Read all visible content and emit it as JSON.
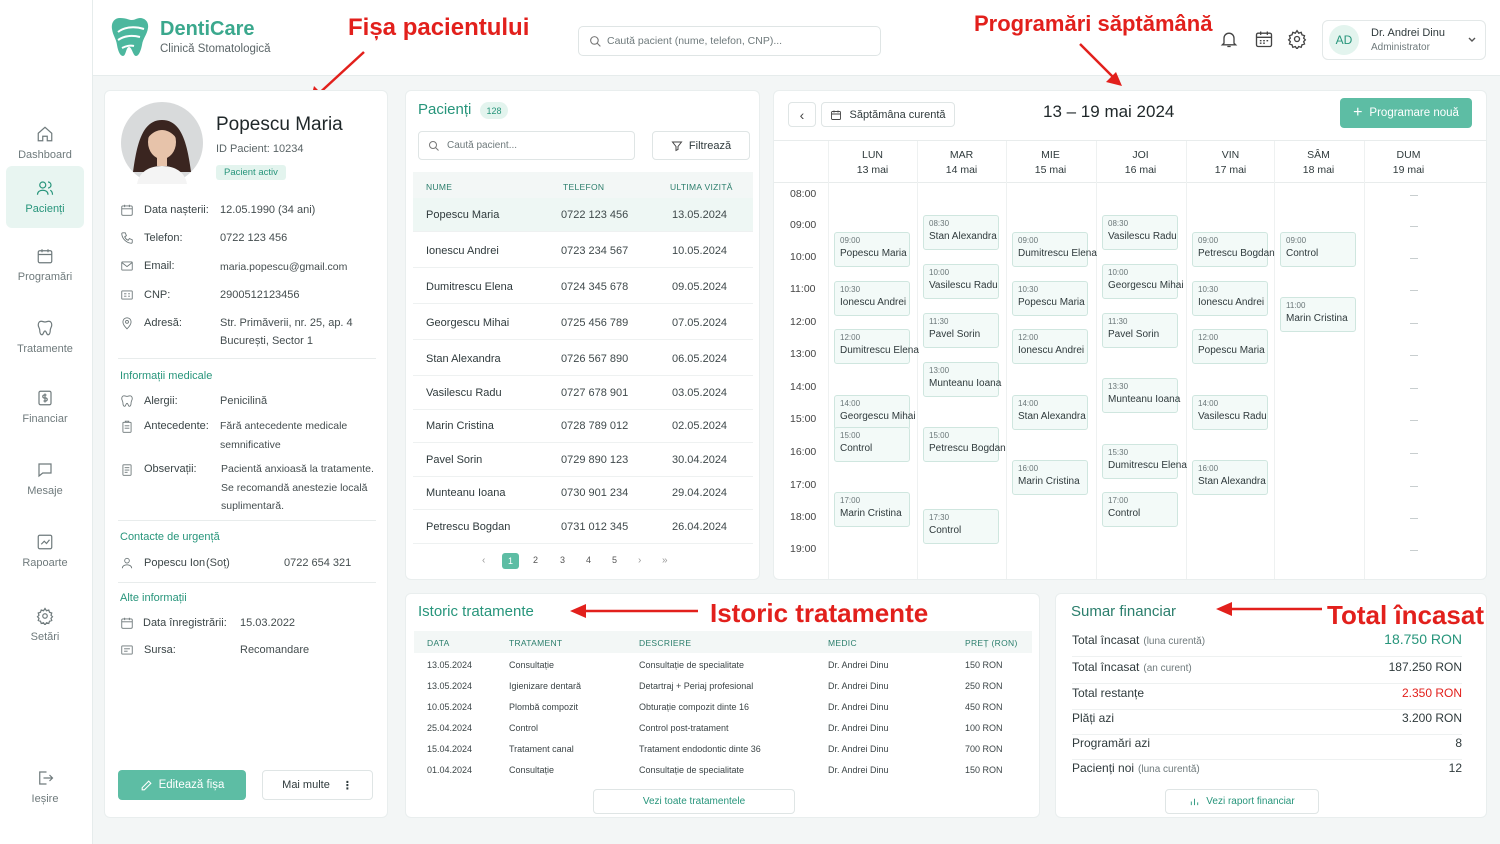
{
  "app": {
    "name": "DentiCare",
    "subtitle": "Clinică Stomatologică"
  },
  "header": {
    "search_placeholder": "Caută pacient (nume, telefon, CNP)...",
    "user_initials": "AD",
    "user_name": "Dr. Andrei Dinu",
    "user_role": "Administrator"
  },
  "annotations": {
    "fisa": "Fișa pacientului",
    "programari": "Programări săptămână",
    "istoric": "Istoric tratamente",
    "total": "Total încasat"
  },
  "sidebar": {
    "items": [
      {
        "label": "Dashboard",
        "icon": "home-icon"
      },
      {
        "label": "Pacienți",
        "icon": "users-icon"
      },
      {
        "label": "Programări",
        "icon": "calendar-icon"
      },
      {
        "label": "Tratamente",
        "icon": "tooth-icon"
      },
      {
        "label": "Financiar",
        "icon": "dollar-icon"
      },
      {
        "label": "Mesaje",
        "icon": "message-icon"
      },
      {
        "label": "Rapoarte",
        "icon": "chart-icon"
      },
      {
        "label": "Setări",
        "icon": "gear-icon"
      }
    ],
    "logout": "Ieșire"
  },
  "patient": {
    "name": "Popescu Maria",
    "id": "ID Pacient: 10234",
    "status": "Pacient activ",
    "fields": [
      {
        "label": "Data nașterii:",
        "value": "12.05.1990",
        "extra": "(34 ani)"
      },
      {
        "label": "Telefon:",
        "value": "0722 123 456"
      },
      {
        "label": "Email:",
        "value": "maria.popescu@gmail.com"
      },
      {
        "label": "CNP:",
        "value": "2900512123456"
      },
      {
        "label": "Adresă:",
        "value": "Str. Primăverii, nr. 25, ap. 4",
        "value2": "București, Sector 1"
      }
    ],
    "medical_title": "Informații medicale",
    "medical": [
      {
        "label": "Alergii:",
        "value": "Penicilină"
      },
      {
        "label": "Antecedente:",
        "value": "Fără antecedente medicale",
        "value2": "semnificative"
      },
      {
        "label": "Observații:",
        "value": "Pacientă anxioasă la tratamente.",
        "value2": "Se recomandă anestezie locală",
        "value3": "suplimentară."
      }
    ],
    "emergency_title": "Contacte de urgență",
    "emergency": {
      "name": "Popescu Ion",
      "relation": "(Soț)",
      "phone": "0722 654 321"
    },
    "other_title": "Alte informații",
    "other": [
      {
        "label": "Data înregistrării:",
        "value": "15.03.2022"
      },
      {
        "label": "Sursa:",
        "value": "Recomandare"
      }
    ],
    "edit_label": "Editează fișa",
    "more_label": "Mai multe"
  },
  "patients": {
    "title": "Pacienți",
    "count": "128",
    "search_placeholder": "Caută pacient...",
    "filter_label": "Filtrează",
    "columns": [
      "NUME",
      "TELEFON",
      "ULTIMA VIZITĂ"
    ],
    "rows": [
      [
        "Popescu Maria",
        "0722 123 456",
        "13.05.2024"
      ],
      [
        "Ionescu Andrei",
        "0723 234 567",
        "10.05.2024"
      ],
      [
        "Dumitrescu Elena",
        "0724 345 678",
        "09.05.2024"
      ],
      [
        "Georgescu Mihai",
        "0725 456 789",
        "07.05.2024"
      ],
      [
        "Stan Alexandra",
        "0726 567 890",
        "06.05.2024"
      ],
      [
        "Vasilescu Radu",
        "0727 678 901",
        "03.05.2024"
      ],
      [
        "Marin Cristina",
        "0728 789 012",
        "02.05.2024"
      ],
      [
        "Pavel Sorin",
        "0729 890 123",
        "30.04.2024"
      ],
      [
        "Munteanu Ioana",
        "0730 901 234",
        "29.04.2024"
      ],
      [
        "Petrescu Bogdan",
        "0731 012 345",
        "26.04.2024"
      ]
    ],
    "pages": [
      "1",
      "2",
      "3",
      "4",
      "5"
    ],
    "prev": "‹",
    "next": "›",
    "last": "»"
  },
  "calendar": {
    "current_week_label": "Săptămâna curentă",
    "range": "13 – 19 mai 2024",
    "new_label": "Programare nouă",
    "days": [
      [
        "LUN",
        "13 mai"
      ],
      [
        "MAR",
        "14 mai"
      ],
      [
        "MIE",
        "15 mai"
      ],
      [
        "JOI",
        "16 mai"
      ],
      [
        "VIN",
        "17 mai"
      ],
      [
        "SÂM",
        "18 mai"
      ],
      [
        "DUM",
        "19 mai"
      ]
    ],
    "hours": [
      "08:00",
      "09:00",
      "10:00",
      "11:00",
      "12:00",
      "13:00",
      "14:00",
      "15:00",
      "16:00",
      "17:00",
      "18:00",
      "19:00"
    ],
    "appointments": [
      {
        "day": 0,
        "time": "09:00",
        "name": "Popescu Maria"
      },
      {
        "day": 0,
        "time": "10:30",
        "name": "Ionescu Andrei"
      },
      {
        "day": 0,
        "time": "12:00",
        "name": "Dumitrescu Elena"
      },
      {
        "day": 0,
        "time": "14:00",
        "name": "Georgescu Mihai"
      },
      {
        "day": 0,
        "time": "15:00",
        "name": "Control"
      },
      {
        "day": 0,
        "time": "17:00",
        "name": "Marin Cristina"
      },
      {
        "day": 1,
        "time": "08:30",
        "name": "Stan Alexandra"
      },
      {
        "day": 1,
        "time": "10:00",
        "name": "Vasilescu Radu"
      },
      {
        "day": 1,
        "time": "11:30",
        "name": "Pavel Sorin"
      },
      {
        "day": 1,
        "time": "13:00",
        "name": "Munteanu Ioana"
      },
      {
        "day": 1,
        "time": "15:00",
        "name": "Petrescu Bogdan"
      },
      {
        "day": 1,
        "time": "17:30",
        "name": "Control"
      },
      {
        "day": 2,
        "time": "09:00",
        "name": "Dumitrescu Elena"
      },
      {
        "day": 2,
        "time": "10:30",
        "name": "Popescu Maria"
      },
      {
        "day": 2,
        "time": "12:00",
        "name": "Ionescu Andrei"
      },
      {
        "day": 2,
        "time": "14:00",
        "name": "Stan Alexandra"
      },
      {
        "day": 2,
        "time": "16:00",
        "name": "Marin Cristina"
      },
      {
        "day": 3,
        "time": "08:30",
        "name": "Vasilescu Radu"
      },
      {
        "day": 3,
        "time": "10:00",
        "name": "Georgescu Mihai"
      },
      {
        "day": 3,
        "time": "11:30",
        "name": "Pavel Sorin"
      },
      {
        "day": 3,
        "time": "13:30",
        "name": "Munteanu Ioana"
      },
      {
        "day": 3,
        "time": "15:30",
        "name": "Dumitrescu Elena"
      },
      {
        "day": 3,
        "time": "17:00",
        "name": "Control"
      },
      {
        "day": 4,
        "time": "09:00",
        "name": "Petrescu Bogdan"
      },
      {
        "day": 4,
        "time": "10:30",
        "name": "Ionescu Andrei"
      },
      {
        "day": 4,
        "time": "12:00",
        "name": "Popescu Maria"
      },
      {
        "day": 4,
        "time": "14:00",
        "name": "Vasilescu Radu"
      },
      {
        "day": 4,
        "time": "16:00",
        "name": "Stan Alexandra"
      },
      {
        "day": 5,
        "time": "09:00",
        "name": "Control"
      },
      {
        "day": 5,
        "time": "11:00",
        "name": "Marin Cristina"
      }
    ]
  },
  "treatments": {
    "title": "Istoric tratamente",
    "columns": [
      "DATA",
      "TRATAMENT",
      "DESCRIERE",
      "MEDIC",
      "PREȚ (RON)"
    ],
    "rows": [
      [
        "13.05.2024",
        "Consultație",
        "Consultație de specialitate",
        "Dr. Andrei Dinu",
        "150 RON"
      ],
      [
        "13.05.2024",
        "Igienizare dentară",
        "Detartraj + Periaj profesional",
        "Dr. Andrei Dinu",
        "250 RON"
      ],
      [
        "10.05.2024",
        "Plombă compozit",
        "Obturație compozit dinte 16",
        "Dr. Andrei Dinu",
        "450 RON"
      ],
      [
        "25.04.2024",
        "Control",
        "Control post-tratament",
        "Dr. Andrei Dinu",
        "100 RON"
      ],
      [
        "15.04.2024",
        "Tratament canal",
        "Tratament endodontic dinte 36",
        "Dr. Andrei Dinu",
        "700 RON"
      ],
      [
        "01.04.2024",
        "Consultație",
        "Consultație de specialitate",
        "Dr. Andrei Dinu",
        "150 RON"
      ]
    ],
    "view_all": "Vezi toate tratamentele"
  },
  "finance": {
    "title": "Sumar financiar",
    "rows": [
      {
        "label": "Total încasat",
        "sub": "(luna curentă)",
        "value": "18.750 RON",
        "color": "#27957b"
      },
      {
        "label": "Total încasat",
        "sub": "(an curent)",
        "value": "187.250 RON",
        "color": "#2f3a3c"
      },
      {
        "label": "Total restanțe",
        "sub": "",
        "value": "2.350 RON",
        "color": "#e2201c"
      },
      {
        "label": "Plăți azi",
        "sub": "",
        "value": "3.200 RON",
        "color": "#2f3a3c"
      },
      {
        "label": "Programări azi",
        "sub": "",
        "value": "8",
        "color": "#2f3a3c"
      },
      {
        "label": "Pacienți noi",
        "sub": "(luna curentă)",
        "value": "12",
        "color": "#2f3a3c"
      }
    ],
    "report_label": "Vezi raport financiar"
  }
}
